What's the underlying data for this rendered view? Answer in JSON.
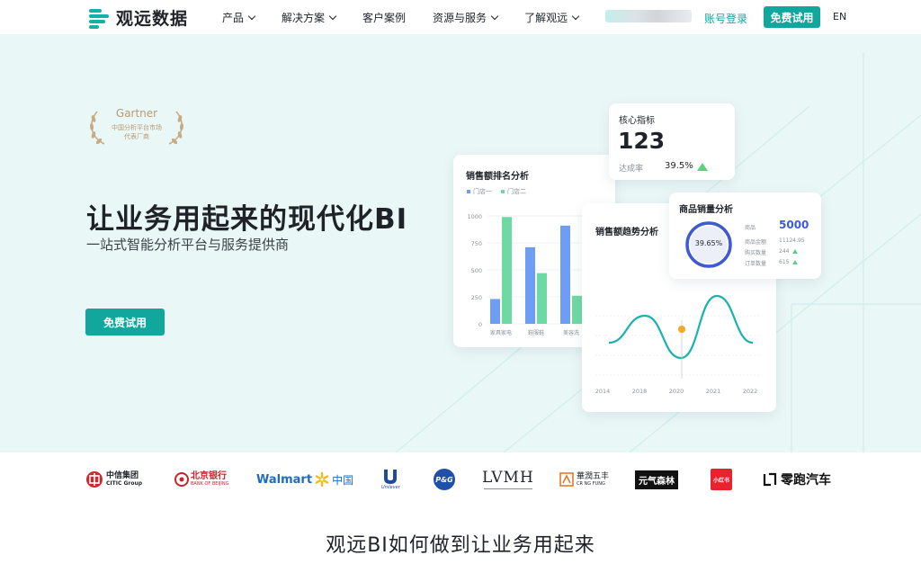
{
  "header": {
    "logo_text": "观远数据",
    "nav": [
      {
        "label": "产品",
        "dropdown": true
      },
      {
        "label": "解决方案",
        "dropdown": true
      },
      {
        "label": "客户案例",
        "dropdown": false
      },
      {
        "label": "资源与服务",
        "dropdown": true
      },
      {
        "label": "了解观远",
        "dropdown": true
      }
    ],
    "login_label": "账号登录",
    "trial_label": "免费试用",
    "lang_label": "EN"
  },
  "hero": {
    "gartner_title": "Gartner",
    "gartner_line1": "中国分析平台市场",
    "gartner_line2": "代表厂商",
    "headline": "让业务用起来的现代化BI",
    "subline": "一站式智能分析平台与服务提供商",
    "cta_label": "免费试用"
  },
  "colors": {
    "accent": "#11a79d",
    "bar_blue": "#6e9df5",
    "bar_green": "#6fd9a4",
    "line_teal": "#19b2ae",
    "ring_blue": "#3f5bd1"
  },
  "cards": {
    "kpi": {
      "title": "核心指标",
      "value": "123",
      "rate_label": "达成率",
      "rate_value": "39.5%"
    },
    "ranking": {
      "title": "销售额排名分析",
      "legend": [
        "门店一",
        "门店二"
      ],
      "y_ticks": [
        "1000",
        "750",
        "500",
        "250",
        "0"
      ],
      "categories": [
        "家具家电",
        "鞋服鞋",
        "美容洗"
      ]
    },
    "trend": {
      "title": "销售额趋势分析",
      "x_ticks": [
        "2014",
        "2018",
        "2020",
        "2021",
        "2022"
      ]
    },
    "product": {
      "title": "商品销量分析",
      "ring_percent": "39.65%",
      "rows": [
        {
          "label": "商品",
          "value": "5000"
        },
        {
          "label": "商品金额",
          "value": "11124.95"
        },
        {
          "label": "购买数量",
          "value": "244"
        },
        {
          "label": "订单数量",
          "value": "615"
        }
      ]
    }
  },
  "chart_data": [
    {
      "type": "bar",
      "title": "销售额排名分析",
      "categories": [
        "家具家电",
        "鞋服鞋",
        "美容洗"
      ],
      "series": [
        {
          "name": "门店一",
          "values": [
            230,
            710,
            910
          ]
        },
        {
          "name": "门店二",
          "values": [
            990,
            470,
            260
          ]
        }
      ],
      "ylim": [
        0,
        1000
      ]
    },
    {
      "type": "line",
      "title": "销售额趋势分析",
      "x": [
        "2014",
        "2018",
        "2020",
        "2021",
        "2022"
      ],
      "series": [
        {
          "values": [
            300,
            600,
            130,
            820,
            300
          ]
        }
      ]
    },
    {
      "type": "pie",
      "title": "商品销量分析",
      "values": [
        39.65,
        60.35
      ]
    }
  ],
  "brands": [
    "中信集团",
    "CITIC Group",
    "北京银行",
    "BANK OF BEIJING",
    "Walmart",
    "中国",
    "Unilever",
    "P&G",
    "LVMH",
    "華潤五丰",
    "CR NG FUNG",
    "元气森林",
    "小红书",
    "零跑汽车"
  ],
  "bottom": {
    "title": "观远BI如何做到让业务用起来"
  }
}
